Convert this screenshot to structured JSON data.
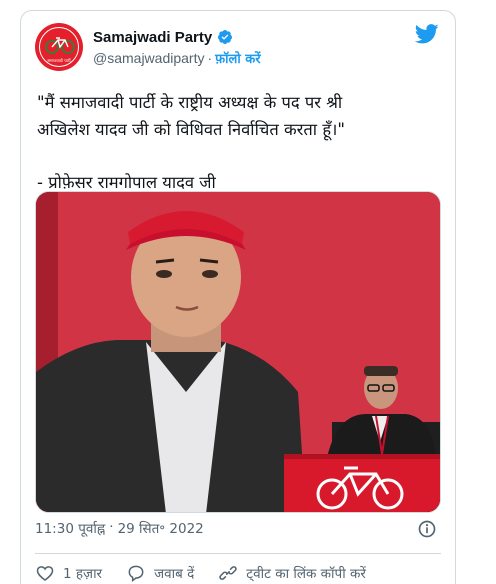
{
  "author": {
    "name": "Samajwadi Party",
    "handle": "@samajwadiparty",
    "separator": "·",
    "follow_label": "फ़ॉलो करें",
    "avatar_caption": "समाजवादी पार्टी"
  },
  "tweet": {
    "line1": "\"मैं समाजवादी पार्टी के राष्ट्रीय अध्यक्ष के पद पर श्री",
    "line2": "अखिलेश यादव जी को विधिवत निर्वाचित करता हूँ।\"",
    "line3": "- प्रोफ़ेसर रामगोपाल यादव जी"
  },
  "meta": {
    "time": "11:30 पूर्वाह्न",
    "separator": "·",
    "date": "29 सित॰ 2022"
  },
  "actions": {
    "like_count": "1 हज़ार",
    "reply_label": "जवाब दें",
    "copy_link_label": "ट्वीट का लिंक कॉपी करें"
  },
  "colors": {
    "accent": "#1d9bf0",
    "muted": "#536471",
    "party_red": "#e3202b",
    "party_green": "#1f8b3a"
  }
}
